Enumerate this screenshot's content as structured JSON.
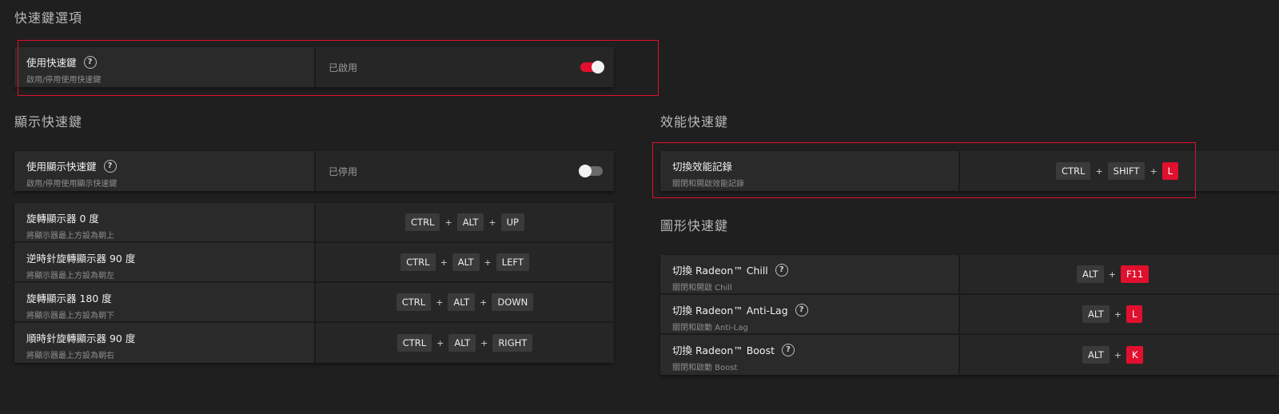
{
  "sections": {
    "hotkey_options": "快速鍵選項",
    "display_hotkeys": "顯示快速鍵",
    "performance_hotkeys": "效能快速鍵",
    "graphics_hotkeys": "圖形快速鍵"
  },
  "use_hotkeys": {
    "title": "使用快速鍵",
    "sub": "啟用/停用使用快速鍵",
    "state": "已啟用",
    "enabled": true
  },
  "use_display_hotkeys": {
    "title": "使用顯示快速鍵",
    "sub": "啟用/停用使用顯示快速鍵",
    "state": "已停用",
    "enabled": false
  },
  "display_rows": [
    {
      "title": "旋轉顯示器 0 度",
      "sub": "將顯示器最上方設為朝上",
      "keys": [
        "CTRL",
        "ALT",
        "UP"
      ]
    },
    {
      "title": "逆時針旋轉顯示器 90 度",
      "sub": "將顯示器最上方設為朝左",
      "keys": [
        "CTRL",
        "ALT",
        "LEFT"
      ]
    },
    {
      "title": "旋轉顯示器 180 度",
      "sub": "將顯示器最上方設為朝下",
      "keys": [
        "CTRL",
        "ALT",
        "DOWN"
      ]
    },
    {
      "title": "順時針旋轉顯示器 90 度",
      "sub": "將顯示器最上方設為朝右",
      "keys": [
        "CTRL",
        "ALT",
        "RIGHT"
      ]
    }
  ],
  "perf_row": {
    "title": "切換效能記錄",
    "sub": "關閉和開啟效能記錄",
    "keys": [
      "CTRL",
      "SHIFT",
      "L"
    ]
  },
  "graphics_rows": [
    {
      "title": "切換 Radeon™ Chill",
      "sub": "關閉和開啟 Chill",
      "keys": [
        "ALT",
        "F11"
      ]
    },
    {
      "title": "切換 Radeon™ Anti-Lag",
      "sub": "關閉和啟動 Anti-Lag",
      "keys": [
        "ALT",
        "L"
      ]
    },
    {
      "title": "切換 Radeon™ Boost",
      "sub": "關閉和啟動 Boost",
      "keys": [
        "ALT",
        "K"
      ]
    }
  ],
  "colors": {
    "accent": "#e0102e",
    "background": "#1f1f1f",
    "panel": "#262626"
  },
  "icons": {
    "help": "question-circle-icon"
  },
  "help_glyph": "?",
  "plus_glyph": "+"
}
